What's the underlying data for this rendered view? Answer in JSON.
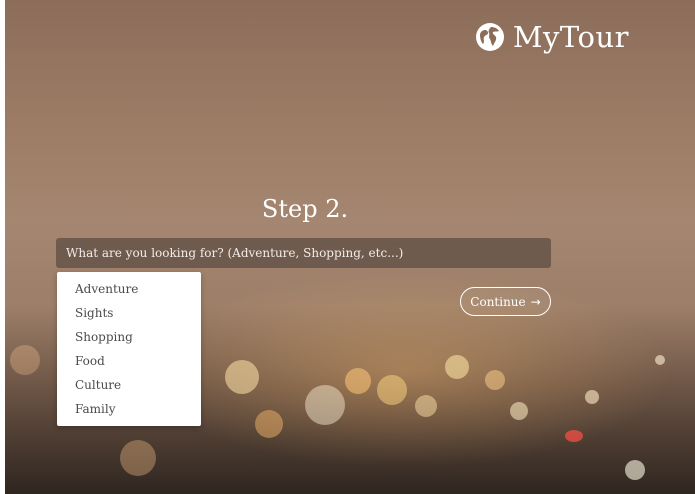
{
  "brand": {
    "name": "MyTour",
    "icon": "globe-icon"
  },
  "step": {
    "title": "Step 2."
  },
  "search": {
    "placeholder": "What are you looking for? (Adventure, Shopping, etc...)",
    "value": ""
  },
  "dropdown": {
    "options": [
      "Adventure",
      "Sights",
      "Shopping",
      "Food",
      "Culture",
      "Family"
    ]
  },
  "continue": {
    "label": "Continue",
    "icon": "arrow-right-icon"
  },
  "colors": {
    "text": "#ffffff",
    "dropdown_text": "#4a4a4a"
  }
}
